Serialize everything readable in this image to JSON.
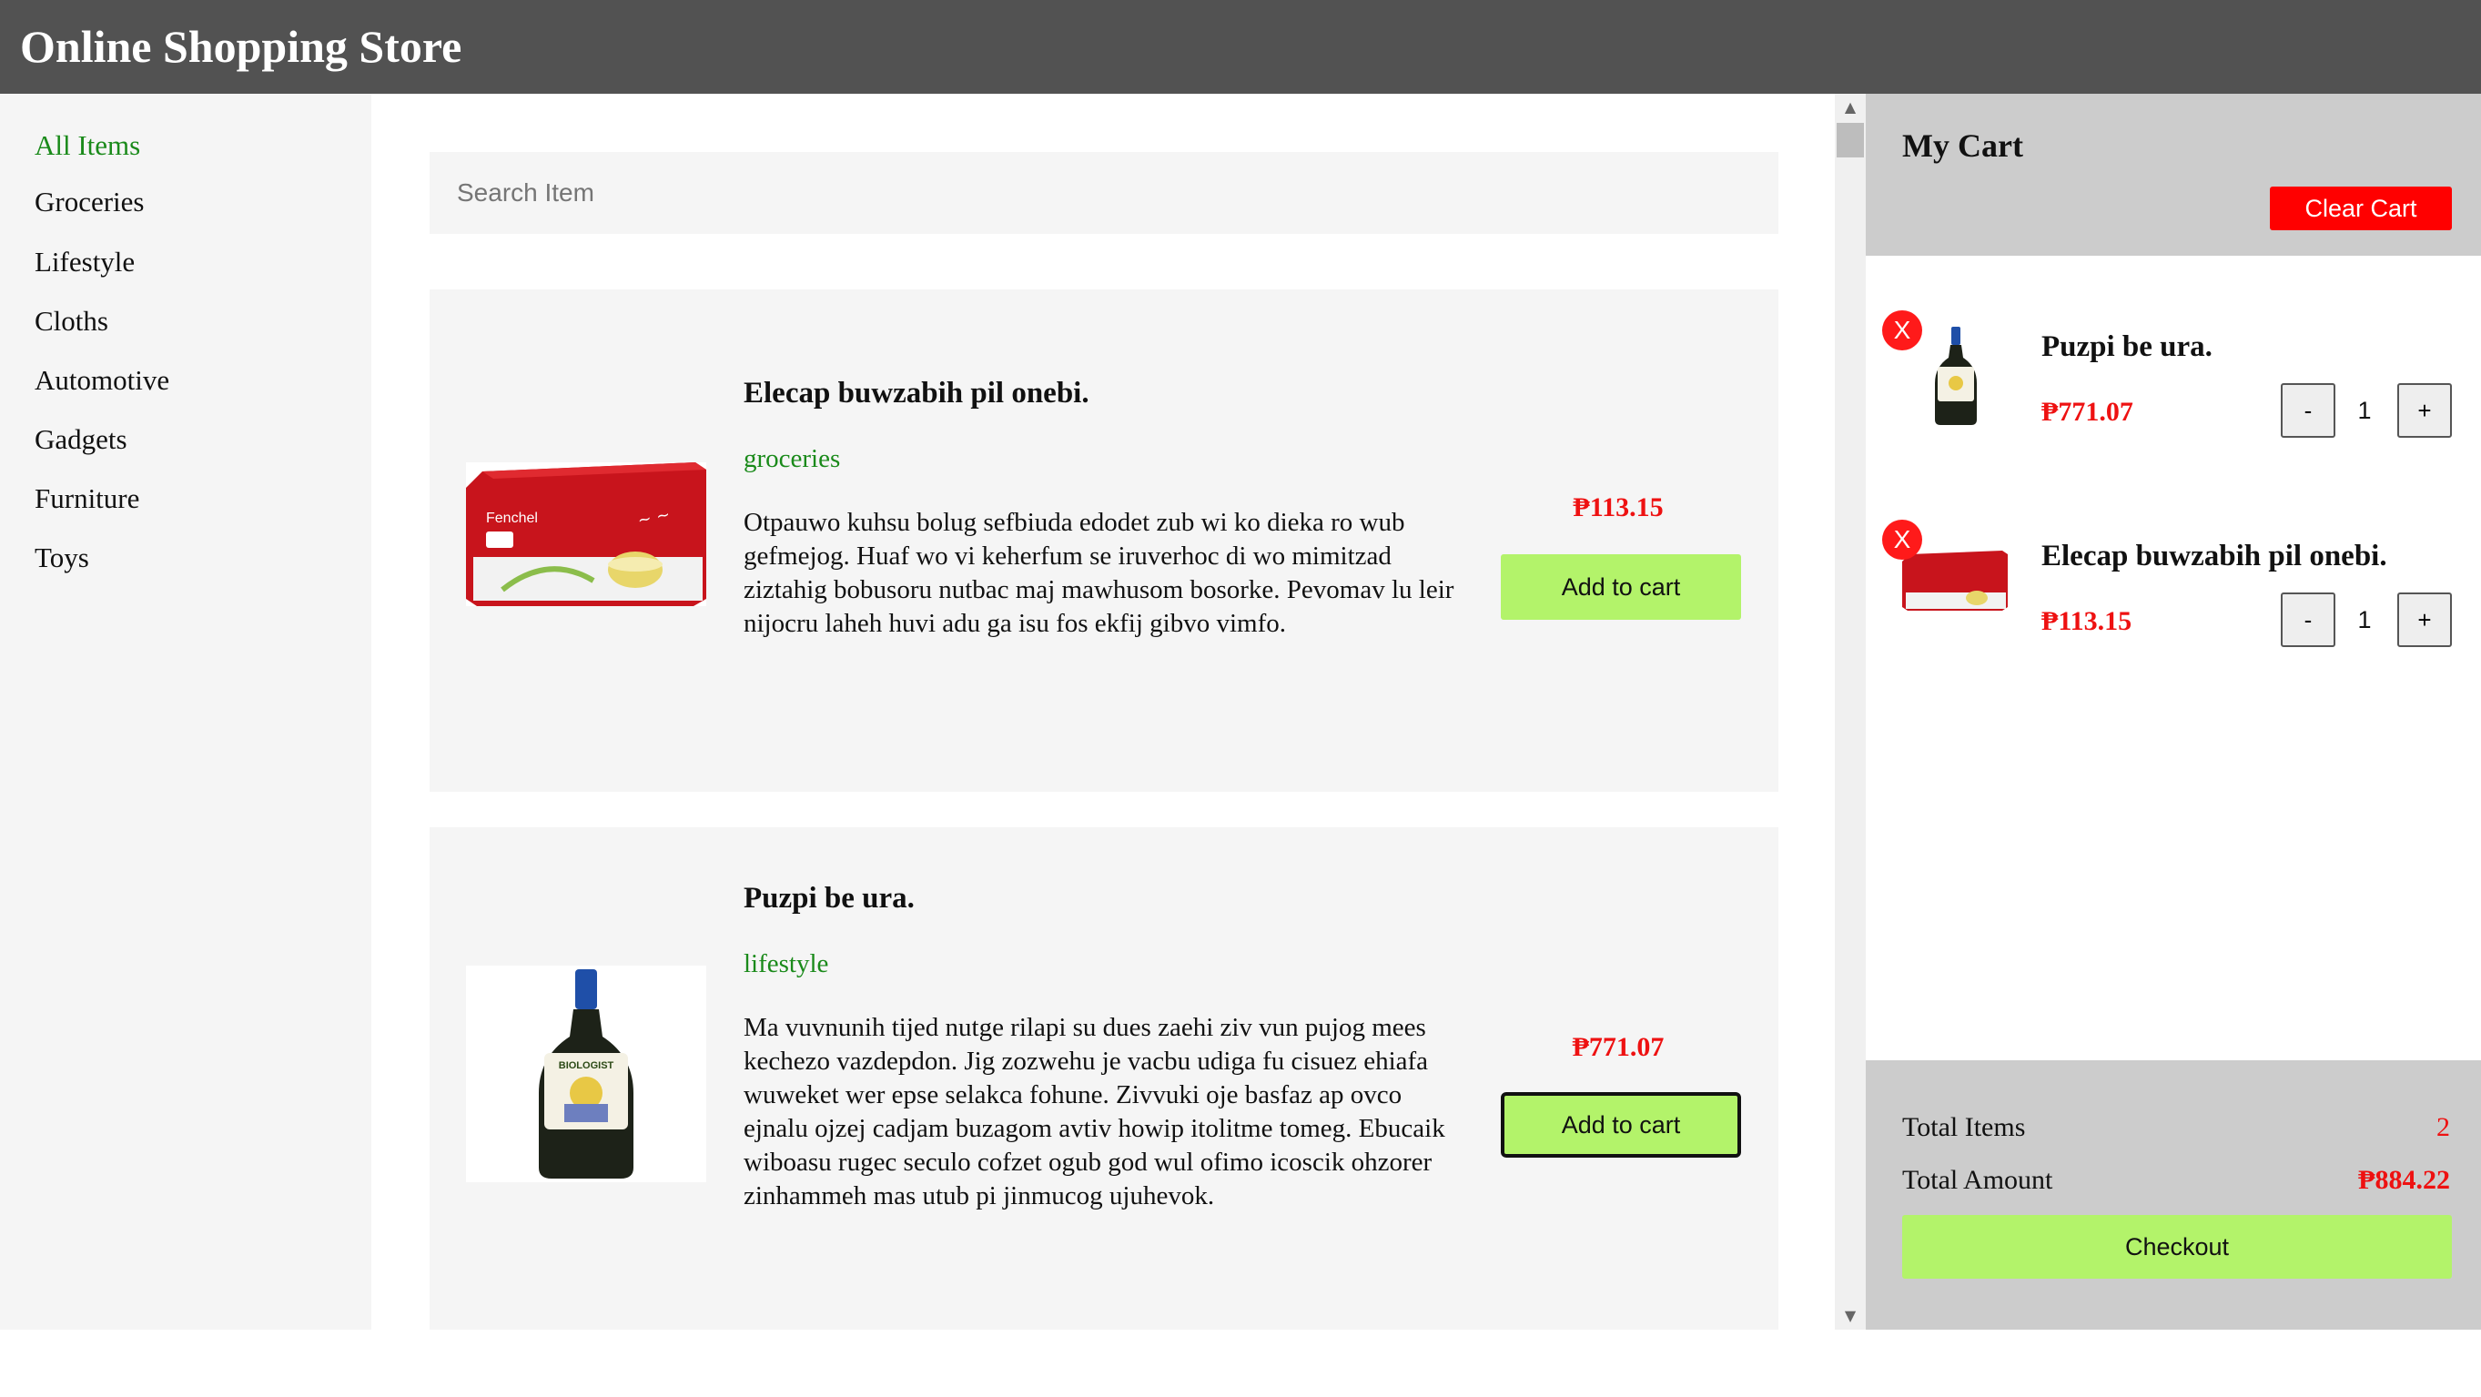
{
  "header": {
    "title": "Online Shopping Store"
  },
  "sidebar": {
    "items": [
      {
        "label": "All Items"
      },
      {
        "label": "Groceries"
      },
      {
        "label": "Lifestyle"
      },
      {
        "label": "Cloths"
      },
      {
        "label": "Automotive"
      },
      {
        "label": "Gadgets"
      },
      {
        "label": "Furniture"
      },
      {
        "label": "Toys"
      }
    ],
    "active_color": "#1a8a1a"
  },
  "search": {
    "placeholder": "Search Item",
    "value": ""
  },
  "products": [
    {
      "title": "Elecap buwzabih pil onebi.",
      "category": "groceries",
      "description": "Otpauwo kuhsu bolug sefbiuda edodet zub wi ko dieka ro wub gefmejog. Huaf wo vi keherfum se iruverhoc di wo mimitzad ziztahig bobusoru nutbac maj mawhusom bosorke. Pevomav lu leir nijocru laheh huvi adu ga isu fos ekfij gibvo vimfo.",
      "price": "₱113.15",
      "button_label": "Add to cart",
      "image_icon": "tea-box-image",
      "image_text": "Fenchel"
    },
    {
      "title": "Puzpi be ura.",
      "category": "lifestyle",
      "description": "Ma vuvnunih tijed nutge rilapi su dues zaehi ziv vun pujog mees kechezo vazdepdon. Jig zozwehu je vacbu udiga fu cisuez ehiafa wuweket wer epse selakca fohune. Zivvuki oje basfaz ap ovco ejnalu ojzej cadjam buzagom avtiv howip itolitme tomeg. Ebucaik wiboasu rugec seculo cofzet ogub god wul ofimo icoscik ohzorer zinhammeh mas utub pi jinmucog ujuhevok.",
      "price": "₱771.07",
      "button_label": "Add to cart",
      "image_icon": "bottle-image",
      "image_text": "BIOLOGIST"
    }
  ],
  "cart": {
    "title": "My Cart",
    "clear_label": "Clear Cart",
    "remove_label": "X",
    "minus_label": "-",
    "plus_label": "+",
    "items": [
      {
        "name": "Puzpi be ura.",
        "price": "₱771.07",
        "qty": "1",
        "image_icon": "bottle-image"
      },
      {
        "name": "Elecap buwzabih pil onebi.",
        "price": "₱113.15",
        "qty": "1",
        "image_icon": "tea-box-image"
      }
    ],
    "summary": {
      "total_items_label": "Total Items",
      "total_items_value": "2",
      "total_amount_label": "Total Amount",
      "total_amount_value": "₱884.22"
    },
    "checkout_label": "Checkout"
  },
  "colors": {
    "header_bg": "#525252",
    "accent_green": "#b3f36a",
    "price_red": "#ee1111",
    "clear_red": "#ff0000"
  }
}
